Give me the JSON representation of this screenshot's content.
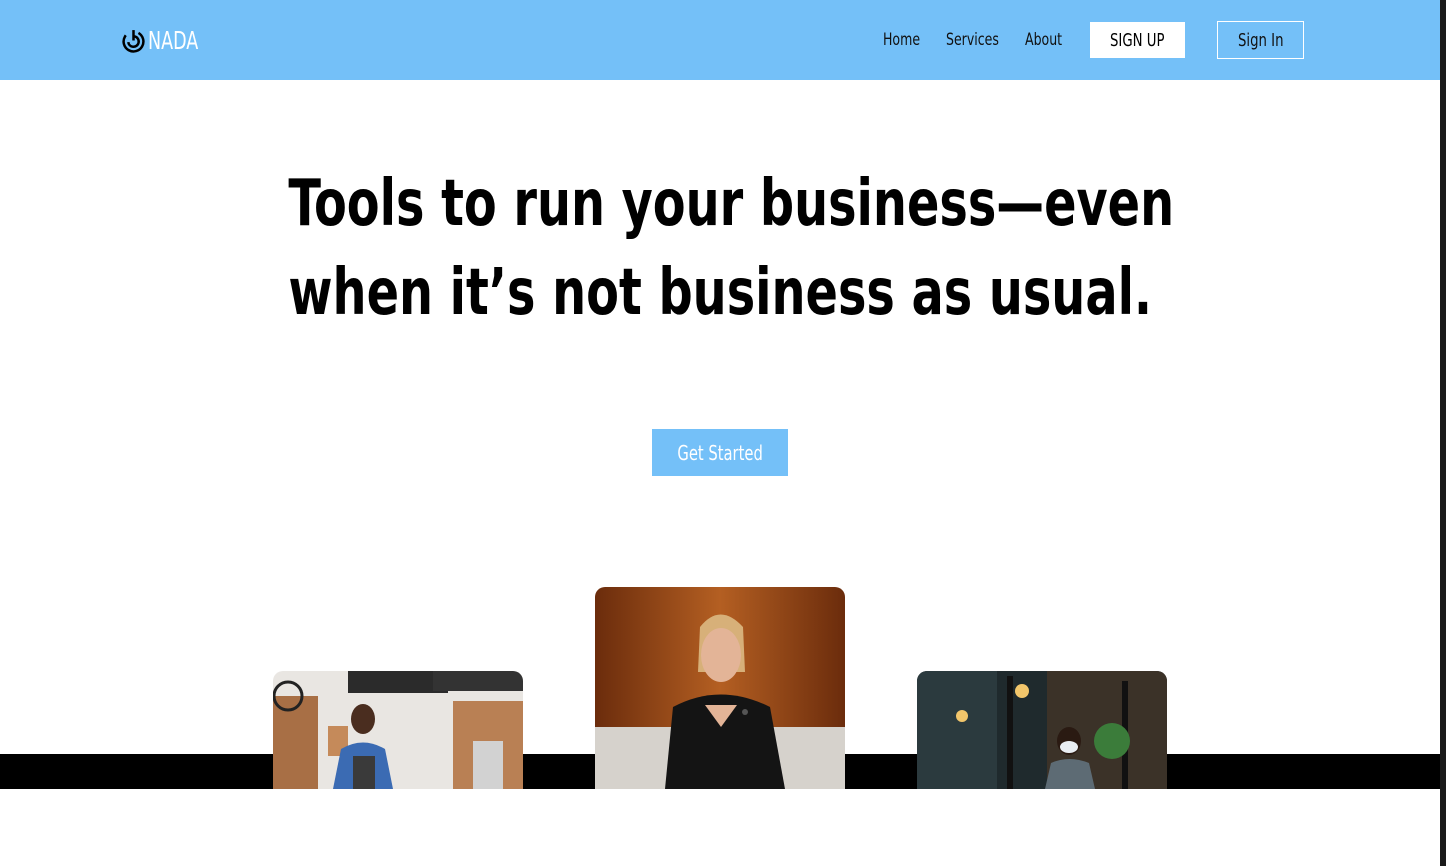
{
  "brand": {
    "name": "NADA",
    "icon": "power-swirl-icon"
  },
  "nav": {
    "links": [
      "Home",
      "Services",
      "About"
    ],
    "signup_label": "SIGN UP",
    "signin_label": "Sign In"
  },
  "hero": {
    "title_line1": "Tools to run your business—even",
    "title_line2": "when it’s not business as usual.",
    "cta_label": "Get Started"
  },
  "colors": {
    "accent": "#74c0f8",
    "band": "#000000"
  }
}
